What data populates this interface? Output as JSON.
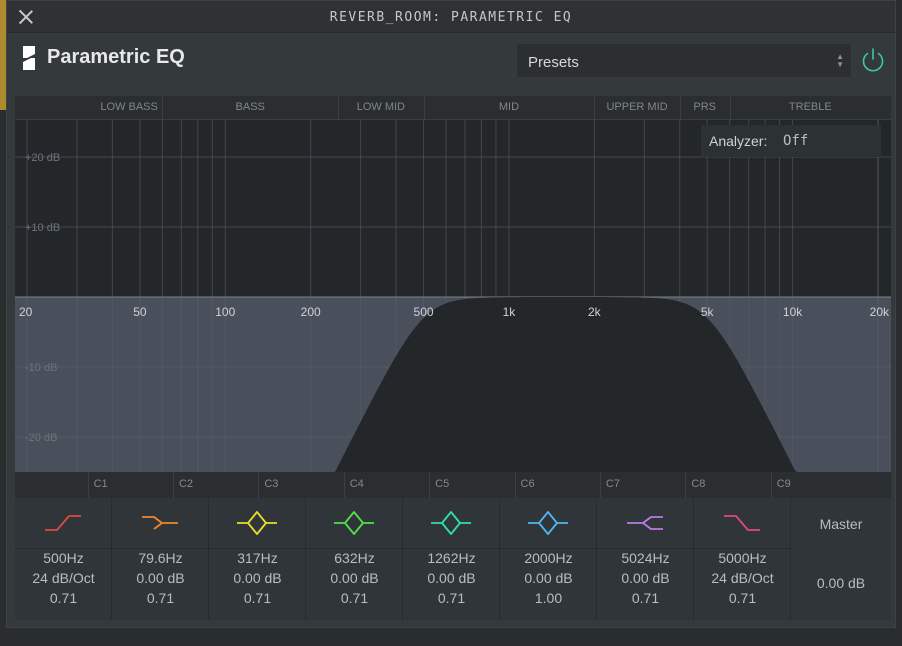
{
  "window": {
    "title": "REVERB_ROOM: PARAMETRIC EQ"
  },
  "header": {
    "app_name": "Parametric EQ",
    "presets_label": "Presets"
  },
  "analyzer": {
    "label": "Analyzer:",
    "value": "Off"
  },
  "band_regions": [
    "LOW BASS",
    "BASS",
    "LOW MID",
    "MID",
    "UPPER MID",
    "PRS",
    "TREBLE"
  ],
  "db_labels": [
    "+20 dB",
    "+10 dB",
    "-10 dB",
    "-20 dB"
  ],
  "freq_labels": [
    "20",
    "50",
    "100",
    "200",
    "500",
    "1k",
    "2k",
    "5k",
    "10k",
    "20k"
  ],
  "notes": [
    "C1",
    "C2",
    "C3",
    "C4",
    "C5",
    "C6",
    "C7",
    "C8",
    "C9"
  ],
  "bands": [
    {
      "type": "low-cut",
      "color": "#e2473f",
      "freq": "500Hz",
      "gain": "24 dB/Oct",
      "q": "0.71"
    },
    {
      "type": "low-shelf",
      "color": "#f0852a",
      "freq": "79.6Hz",
      "gain": "0.00 dB",
      "q": "0.71"
    },
    {
      "type": "bell",
      "color": "#e9dd2e",
      "freq": "317Hz",
      "gain": "0.00 dB",
      "q": "0.71"
    },
    {
      "type": "bell",
      "color": "#52e04a",
      "freq": "632Hz",
      "gain": "0.00 dB",
      "q": "0.71"
    },
    {
      "type": "bell",
      "color": "#2fe0a6",
      "freq": "1262Hz",
      "gain": "0.00 dB",
      "q": "0.71"
    },
    {
      "type": "bell",
      "color": "#4fb6ef",
      "freq": "2000Hz",
      "gain": "0.00 dB",
      "q": "1.00"
    },
    {
      "type": "high-shelf",
      "color": "#b57ee8",
      "freq": "5024Hz",
      "gain": "0.00 dB",
      "q": "0.71"
    },
    {
      "type": "high-cut",
      "color": "#e0467e",
      "freq": "5000Hz",
      "gain": "24 dB/Oct",
      "q": "0.71"
    }
  ],
  "master": {
    "label": "Master",
    "value": "0.00 dB"
  },
  "eq_curve": {
    "low_cut_hz": 500,
    "high_cut_hz": 5000,
    "slope_db_per_oct": 24,
    "db_range": [
      -25,
      25
    ]
  },
  "colors": {
    "accent": "#3cc6a8"
  }
}
